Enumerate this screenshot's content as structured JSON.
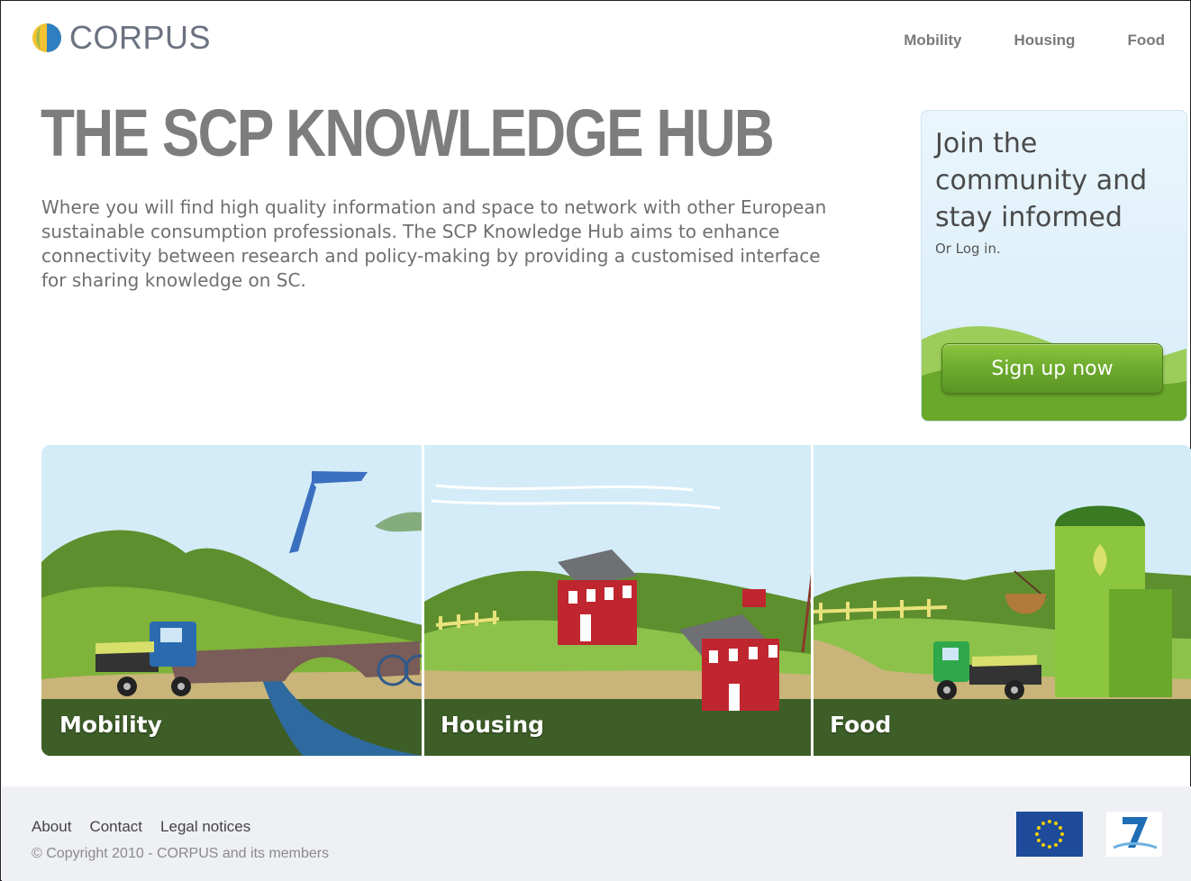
{
  "brand": {
    "name": "CORPUS",
    "logo_icon": "globe-icon"
  },
  "nav": {
    "items": [
      "Mobility",
      "Housing",
      "Food"
    ]
  },
  "hero": {
    "title": "THE SCP KNOWLEDGE HUB",
    "intro": "Where you will find high quality information and space to network with other European sustainable consumption professionals. The SCP Knowledge Hub aims to enhance connectivity between research and policy-making by providing a customised interface for sharing knowledge on SC."
  },
  "join": {
    "title": "Join the community and stay informed",
    "login_text": "Or Log in.",
    "signup_label": "Sign up now"
  },
  "themes": [
    {
      "label": "Mobility",
      "icon": "hang-glider-truck-bridge-illustration"
    },
    {
      "label": "Housing",
      "icon": "houses-windmill-illustration"
    },
    {
      "label": "Food",
      "icon": "silo-truck-illustration"
    }
  ],
  "footer": {
    "links": [
      "About",
      "Contact",
      "Legal notices"
    ],
    "copyright": "© Copyright 2010 - CORPUS and its members",
    "eu_flag_icon": "eu-flag-icon",
    "fp7_icon": "fp7-logo-icon"
  },
  "colors": {
    "brand_green": "#6aa82c",
    "sky": "#d4ecf8",
    "grass": "#7fb33a",
    "dark_band": "#3d5e27",
    "house_red": "#c0262f"
  }
}
